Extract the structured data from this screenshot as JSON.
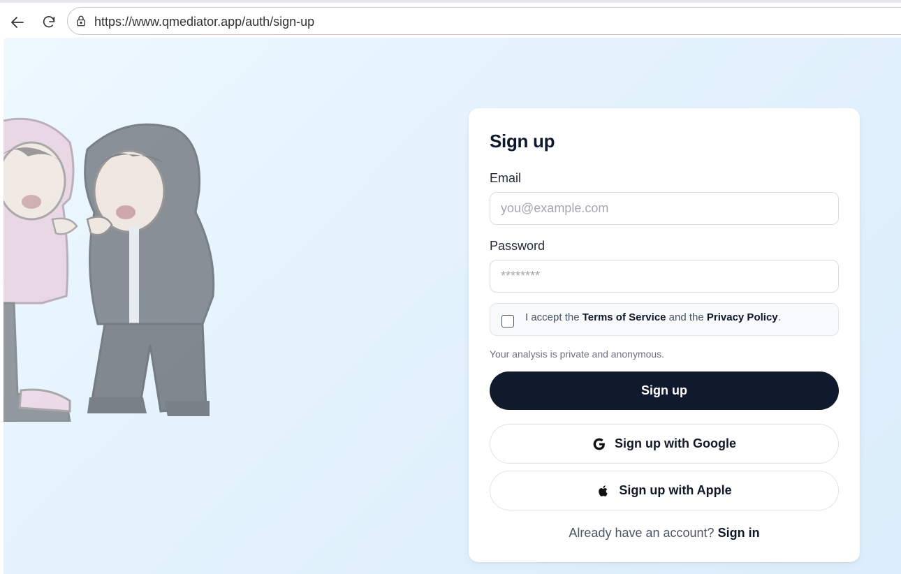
{
  "browser": {
    "url": "https://www.qmediator.app/auth/sign-up",
    "icons": {
      "back": "arrow-left-icon",
      "reload": "reload-icon",
      "lock": "lock-icon"
    }
  },
  "signup": {
    "title": "Sign up",
    "email": {
      "label": "Email",
      "placeholder": "you@example.com",
      "value": ""
    },
    "password": {
      "label": "Password",
      "placeholder": "********",
      "value": ""
    },
    "terms": {
      "prefix": "I accept the ",
      "terms_link": "Terms of Service",
      "middle": " and the ",
      "privacy_link": "Privacy Policy",
      "suffix": ".",
      "checked": false
    },
    "privacy_note": "Your analysis is private and anonymous.",
    "submit_label": "Sign up",
    "google_label": "Sign up with Google",
    "apple_label": "Sign up with Apple",
    "signin_prompt": "Already have an account? ",
    "signin_link": "Sign in"
  },
  "colors": {
    "primary_button": "#111a2c",
    "page_background": "#e3f2fd",
    "card_background": "#ffffff"
  }
}
